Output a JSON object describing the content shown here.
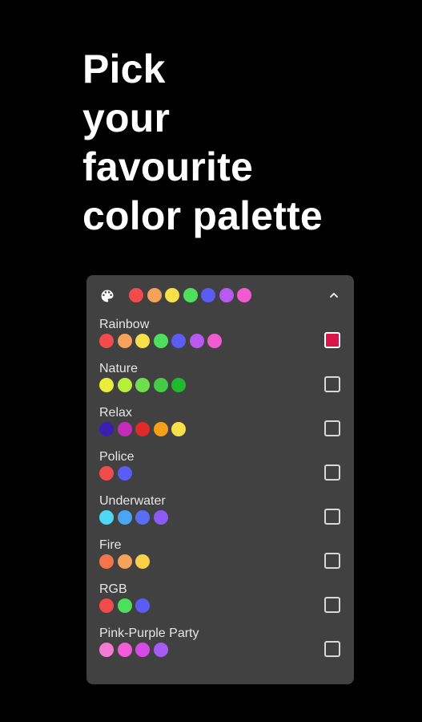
{
  "headline": [
    "Pick",
    "your",
    "favourite",
    "color palette"
  ],
  "panel": {
    "icon": "palette-icon",
    "collapse_icon": "chevron-up-icon",
    "header_colors": [
      "#f24b4b",
      "#f5a25a",
      "#f8e04a",
      "#4ee05d",
      "#5a5cf5",
      "#b85af0",
      "#f25ad2"
    ],
    "palettes": [
      {
        "label": "Rainbow",
        "colors": [
          "#f24b4b",
          "#f5a25a",
          "#f8e04a",
          "#4ee05d",
          "#5a5cf5",
          "#b85af0",
          "#f25ad2"
        ],
        "selected": true
      },
      {
        "label": "Nature",
        "colors": [
          "#e8ee3a",
          "#b6ee3a",
          "#6ee04e",
          "#44cc44",
          "#22b82e"
        ],
        "selected": false
      },
      {
        "label": "Relax",
        "colors": [
          "#3a1fb0",
          "#c42bb8",
          "#e02a2a",
          "#f5a018",
          "#f8e04a"
        ],
        "selected": false
      },
      {
        "label": "Police",
        "colors": [
          "#f24b4b",
          "#5a5cf5"
        ],
        "selected": false
      },
      {
        "label": "Underwater",
        "colors": [
          "#4ed8f5",
          "#4aa6f5",
          "#5a6ef5",
          "#8a5cf5"
        ],
        "selected": false
      },
      {
        "label": "Fire",
        "colors": [
          "#f5744a",
          "#f5a25a",
          "#f8d04a"
        ],
        "selected": false
      },
      {
        "label": "RGB",
        "colors": [
          "#f24b4b",
          "#4ee05d",
          "#5a5cf5"
        ],
        "selected": false
      },
      {
        "label": "Pink-Purple Party",
        "colors": [
          "#f57ad2",
          "#f25ad8",
          "#d84ae8",
          "#a85af5"
        ],
        "selected": false
      }
    ],
    "checked_color": "#d9164a"
  }
}
